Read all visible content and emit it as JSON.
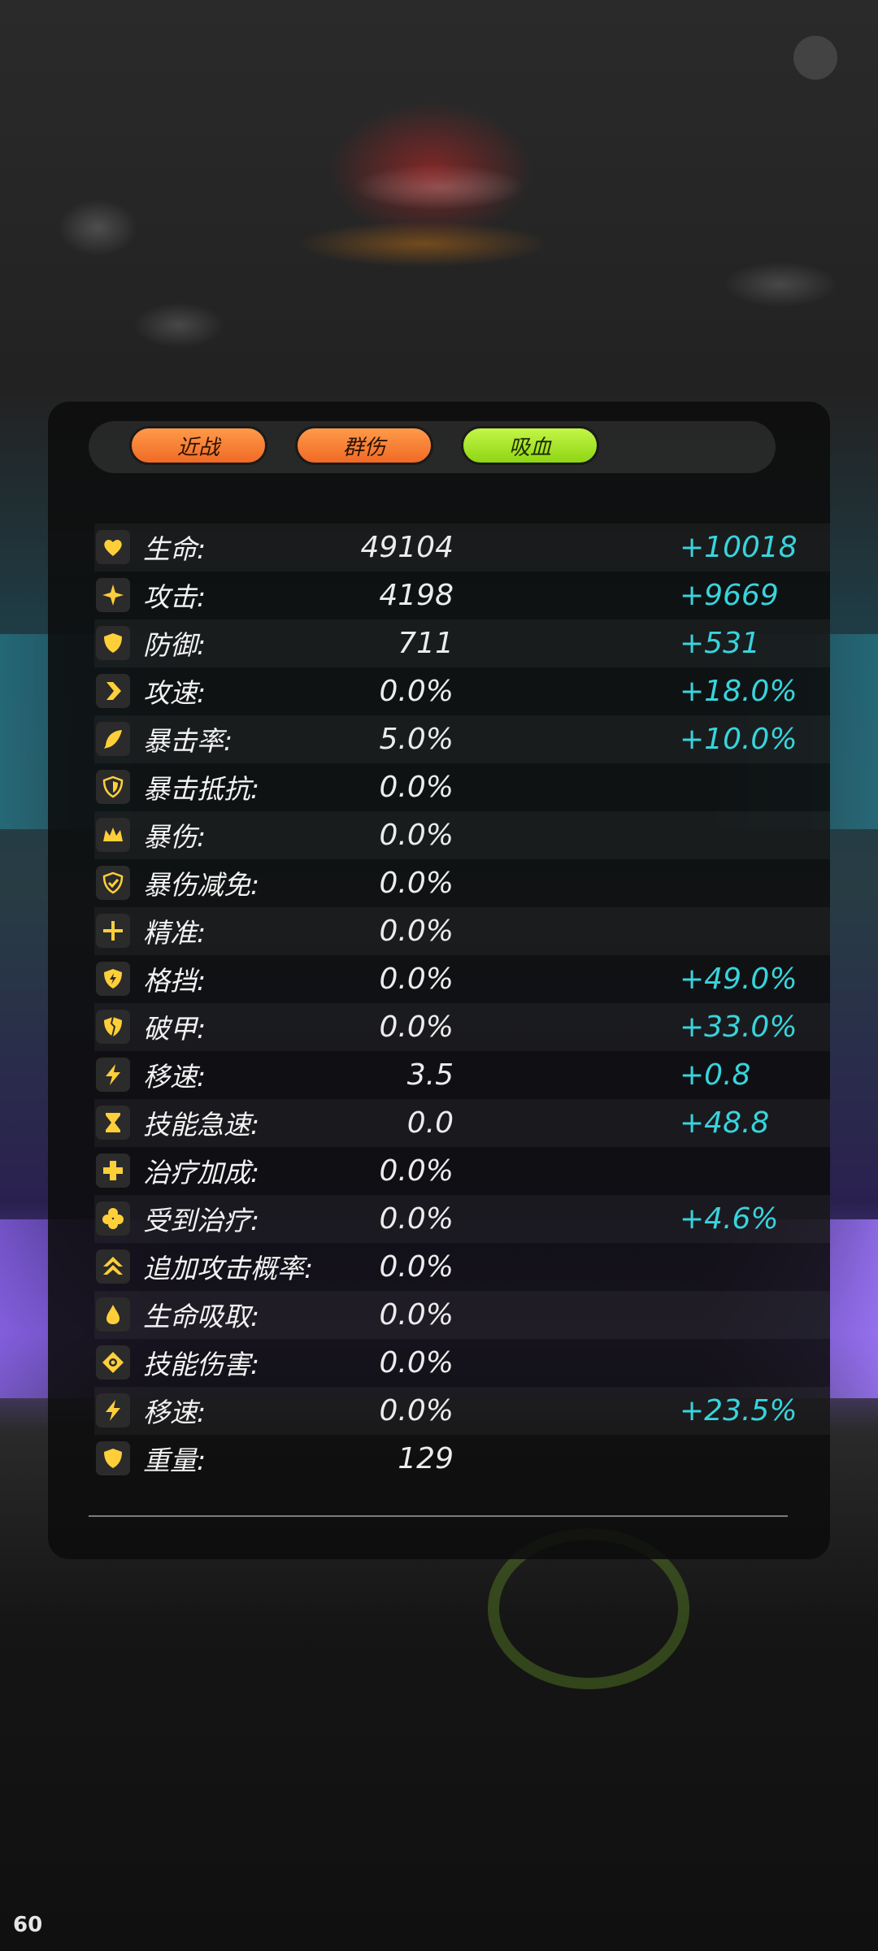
{
  "fps_counter": "60",
  "tags": [
    "近战",
    "群伤",
    "吸血"
  ],
  "colors": {
    "tag_orange": "#f47a30",
    "tag_green": "#9ade1e",
    "icon_yellow": "#ffcf3a",
    "bonus_cyan": "#38d4dc",
    "text_white": "#f2f2f2"
  },
  "stats": [
    {
      "icon": "heart-icon",
      "name": "生命:",
      "base": "49104",
      "bonus": "+10018"
    },
    {
      "icon": "sparkle-icon",
      "name": "攻击:",
      "base": "4198",
      "bonus": "+9669"
    },
    {
      "icon": "shield-icon",
      "name": "防御:",
      "base": "711",
      "bonus": "+531"
    },
    {
      "icon": "chevron-right-icon",
      "name": "攻速:",
      "base": "0.0%",
      "bonus": "+18.0%"
    },
    {
      "icon": "feather-icon",
      "name": "暴击率:",
      "base": "5.0%",
      "bonus": "+10.0%"
    },
    {
      "icon": "shield-outline-icon",
      "name": "暴击抵抗:",
      "base": "0.0%",
      "bonus": ""
    },
    {
      "icon": "crown-icon",
      "name": "暴伤:",
      "base": "0.0%",
      "bonus": ""
    },
    {
      "icon": "shield-check-icon",
      "name": "暴伤减免:",
      "base": "0.0%",
      "bonus": ""
    },
    {
      "icon": "crosshair-icon",
      "name": "精准:",
      "base": "0.0%",
      "bonus": ""
    },
    {
      "icon": "shield-bolt-icon",
      "name": "格挡:",
      "base": "0.0%",
      "bonus": "+49.0%"
    },
    {
      "icon": "broken-shield-icon",
      "name": "破甲:",
      "base": "0.0%",
      "bonus": "+33.0%"
    },
    {
      "icon": "lightning-icon",
      "name": "移速:",
      "base": "3.5",
      "bonus": "+0.8"
    },
    {
      "icon": "hourglass-icon",
      "name": "技能急速:",
      "base": "0.0",
      "bonus": "+48.8"
    },
    {
      "icon": "plus-icon",
      "name": "治疗加成:",
      "base": "0.0%",
      "bonus": ""
    },
    {
      "icon": "clover-icon",
      "name": "受到治疗:",
      "base": "0.0%",
      "bonus": "+4.6%"
    },
    {
      "icon": "double-chevron-up-icon",
      "name": "追加攻击概率:",
      "base": "0.0%",
      "bonus": ""
    },
    {
      "icon": "droplet-icon",
      "name": "生命吸取:",
      "base": "0.0%",
      "bonus": ""
    },
    {
      "icon": "target-icon",
      "name": "技能伤害:",
      "base": "0.0%",
      "bonus": ""
    },
    {
      "icon": "lightning-icon",
      "name": "移速:",
      "base": "0.0%",
      "bonus": "+23.5%"
    },
    {
      "icon": "shield-icon",
      "name": "重量:",
      "base": "129",
      "bonus": ""
    }
  ]
}
